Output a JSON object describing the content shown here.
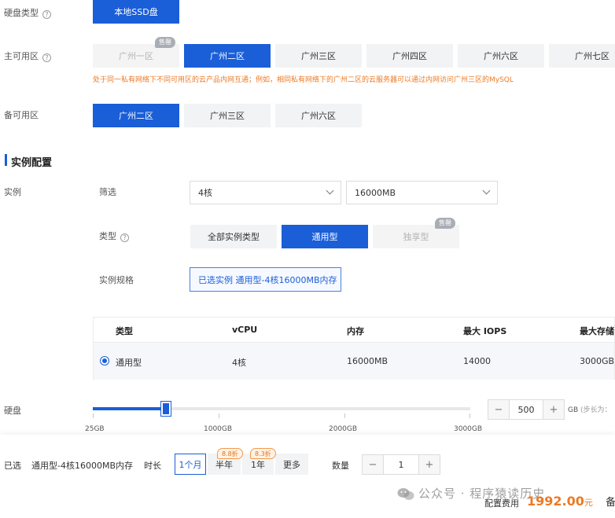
{
  "disk_type": {
    "label": "硬盘类型",
    "option": "本地SSD盘"
  },
  "primary_zone": {
    "label": "主可用区",
    "options": [
      "广州一区",
      "广州二区",
      "广州三区",
      "广州四区",
      "广州六区",
      "广州七区"
    ],
    "sold_out_badge": "售罄",
    "tip": "处于同一私有网络下不同可用区的云产品内网互通；例如，相同私有网络下的广州二区的云服务器可以通过内网访问广州三区的MySQL"
  },
  "backup_zone": {
    "label": "备可用区",
    "options": [
      "广州二区",
      "广州三区",
      "广州六区"
    ]
  },
  "instance_section": {
    "title": "实例配置"
  },
  "instance": {
    "label": "实例",
    "filter_label": "筛选",
    "cpu_select": "4核",
    "memory_select": "16000MB",
    "type_label": "类型",
    "types": [
      "全部实例类型",
      "通用型",
      "独享型"
    ],
    "sold_out_badge": "售罄",
    "spec_label": "实例规格",
    "spec_selected": "已选实例 通用型-4核16000MB内存"
  },
  "spec_table": {
    "headers": [
      "类型",
      "vCPU",
      "内存",
      "最大 IOPS",
      "最大存储"
    ],
    "row": [
      "通用型",
      "4核",
      "16000MB",
      "14000",
      "3000GB"
    ]
  },
  "disk": {
    "label": "硬盘",
    "value": 500,
    "min": 25,
    "max": 3000,
    "value_text": "500",
    "unit": "GB",
    "step_note": "(步长为：",
    "tick_labels": [
      "25GB",
      "1000GB",
      "2000GB",
      "3000GB"
    ]
  },
  "footer": {
    "selected_label": "已选",
    "selected_value": "通用型-4核16000MB内存",
    "duration_label": "时长",
    "durations": [
      "1个月",
      "半年",
      "1年",
      "更多"
    ],
    "discount_half_year": "8.8折",
    "discount_year": "8.3折",
    "quantity_label": "数量",
    "quantity": "1",
    "minus": "−",
    "plus": "+",
    "fee_label": "配置费用",
    "price": "1992.00",
    "price_unit": "元",
    "backup_cut": "备"
  },
  "watermark": {
    "text": "公众号 · 程序猿读历史"
  },
  "colors": {
    "primary": "#1a5ed8",
    "warning": "#ed7a24",
    "disabled_bg": "#f4f4f5"
  }
}
